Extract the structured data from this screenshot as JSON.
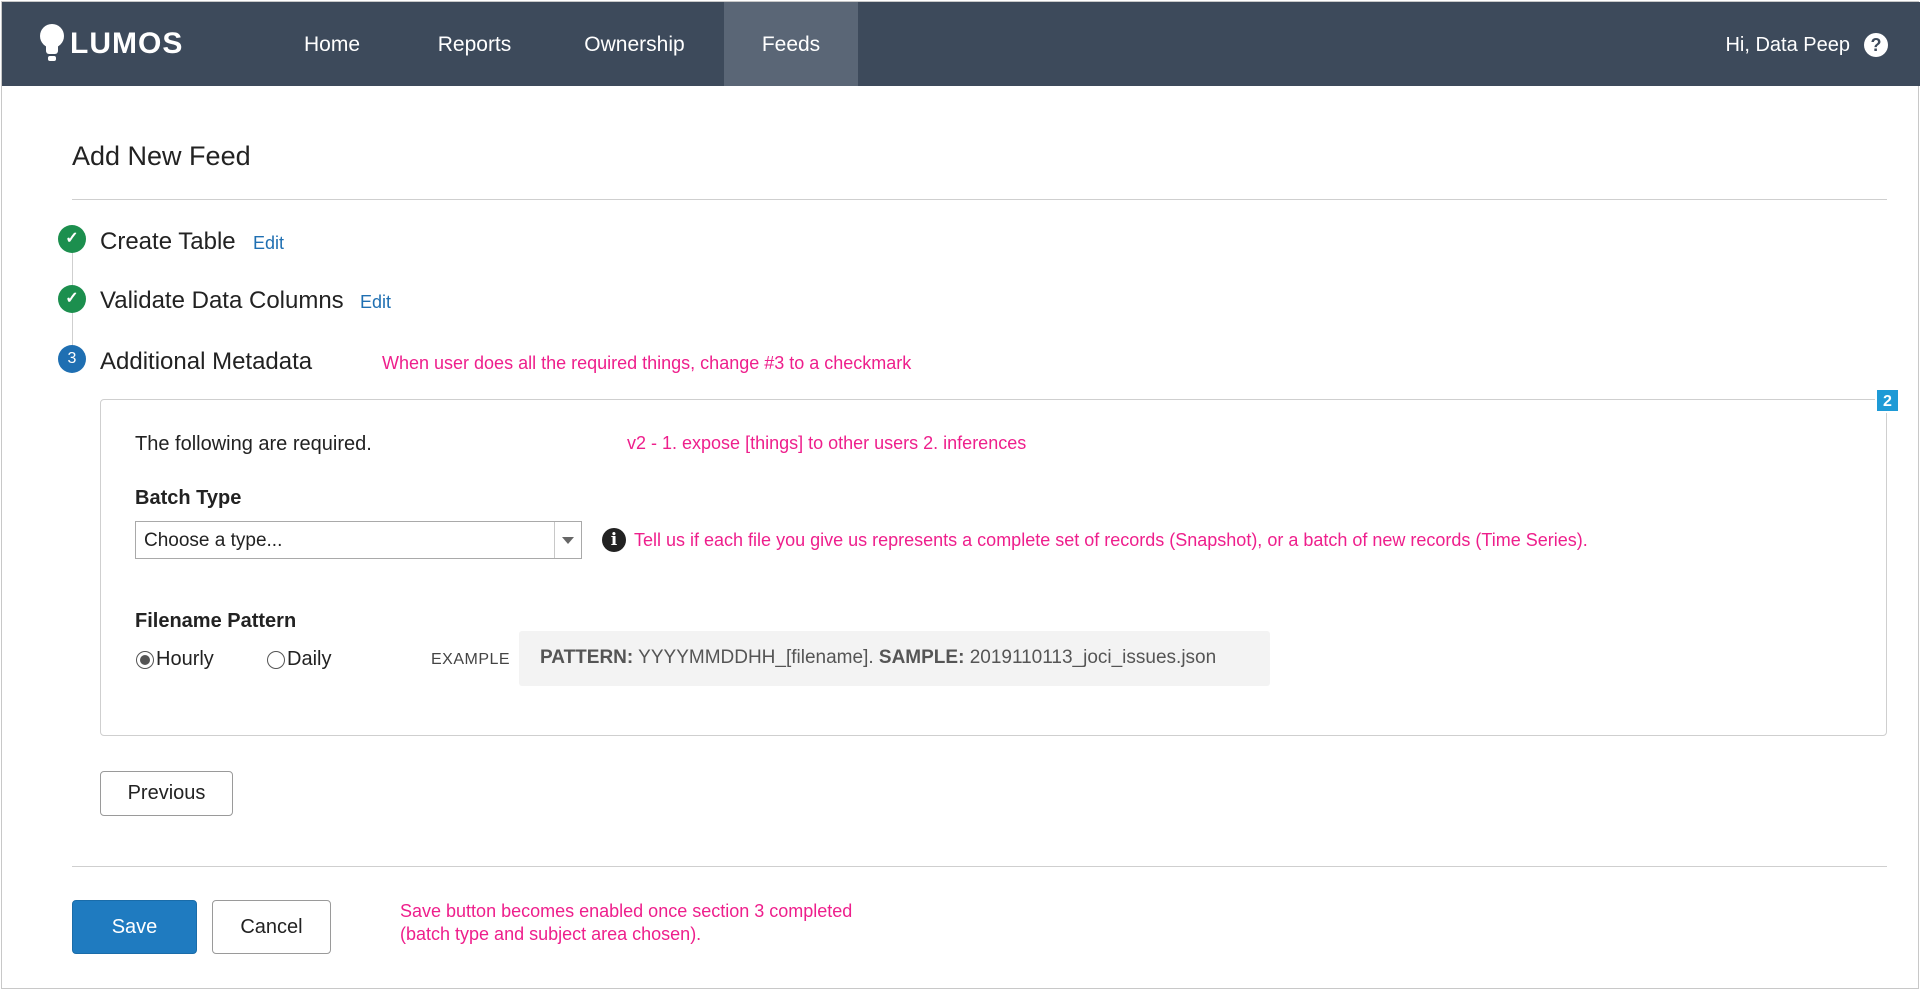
{
  "nav": {
    "brand": "LUMOS",
    "items": [
      "Home",
      "Reports",
      "Ownership",
      "Feeds"
    ],
    "active": "Feeds",
    "greeting": "Hi, Data Peep",
    "help_icon": "?"
  },
  "page": {
    "title": "Add New Feed"
  },
  "steps": [
    {
      "label": "Create Table",
      "status": "done",
      "edit": "Edit"
    },
    {
      "label": "Validate Data Columns",
      "status": "done",
      "edit": "Edit"
    },
    {
      "label": "Additional Metadata",
      "status": "current",
      "number": "3"
    }
  ],
  "notes": {
    "step3": "When user does all the required things, change #3 to a checkmark",
    "v2": "v2 - 1. expose [things] to other users 2. inferences",
    "batch_info": "Tell us if each file you give us represents a complete set of records (Snapshot), or a batch of new records (Time Series).",
    "save_line1": "Save button becomes enabled once section 3 completed",
    "save_line2": "(batch type and subject area chosen)."
  },
  "panel": {
    "badge": "2",
    "required_text": "The following are required.",
    "batch_type_label": "Batch Type",
    "batch_type_value": "Choose a type...",
    "info_icon": "i",
    "filename_pattern_label": "Filename Pattern",
    "radios": [
      {
        "label": "Hourly",
        "checked": true
      },
      {
        "label": "Daily",
        "checked": false
      }
    ],
    "example_label": "EXAMPLE",
    "pattern_key": "PATTERN:",
    "pattern_value": "YYYYMMDDHH_[filename].",
    "sample_key": "SAMPLE:",
    "sample_value": "2019110113_joci_issues.json"
  },
  "buttons": {
    "previous": "Previous",
    "save": "Save",
    "cancel": "Cancel"
  },
  "colors": {
    "nav_bg": "#3d4a5b",
    "nav_active": "#5a6676",
    "done": "#1c8f4e",
    "current": "#1f6fb2",
    "note": "#ee1f8c",
    "primary": "#1f7bc0",
    "badge": "#1e9ad6"
  }
}
